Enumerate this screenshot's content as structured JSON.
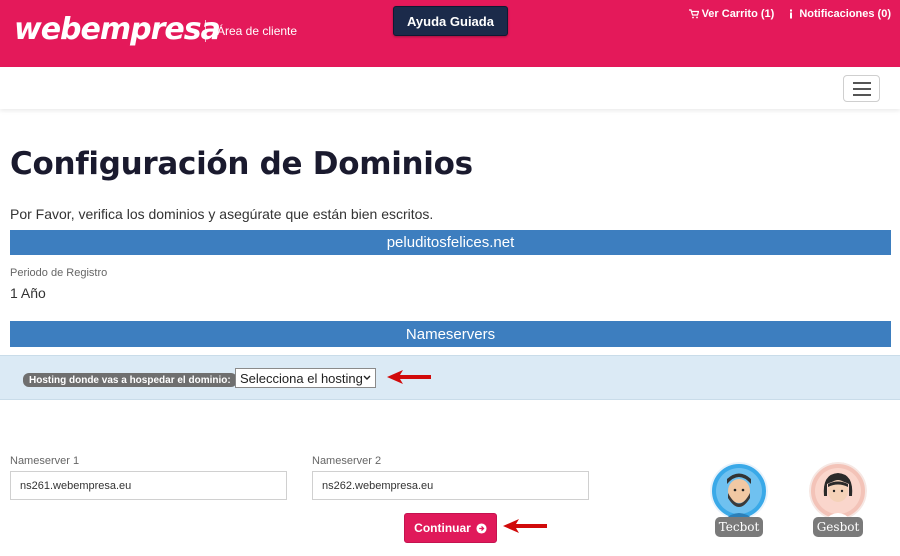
{
  "header": {
    "logo_text": "webempresa",
    "area_cliente": "Área de cliente",
    "ayuda_label": "Ayuda Guiada",
    "cart_label": "Ver Carrito (1)",
    "notifications_label": "Notificaciones (0)"
  },
  "main": {
    "title": "Configuración de Dominios",
    "intro": "Por Favor, verifica los dominios y asegúrate que están bien escritos.",
    "domain": "peluditosfelices.net",
    "period_label": "Periodo de Registro",
    "period_value": "1 Año",
    "nameservers_header": "Nameservers",
    "hosting_label": "Hosting donde vas a hospedar el dominio:",
    "hosting_select_value": "Selecciona el hosting",
    "ns1_label": "Nameserver 1",
    "ns1_value": "ns261.webempresa.eu",
    "ns2_label": "Nameserver 2",
    "ns2_value": "ns262.webempresa.eu",
    "continue_label": "Continuar"
  },
  "bots": {
    "tecbot_label": "Tecbot",
    "gesbot_label": "Gesbot"
  },
  "colors": {
    "brand_pink": "#e4195a",
    "nav_dark": "#1b2a4a",
    "bar_blue": "#3d7ebf",
    "hosting_bg": "#dbeaf5",
    "arrow_red": "#d10a0a"
  }
}
